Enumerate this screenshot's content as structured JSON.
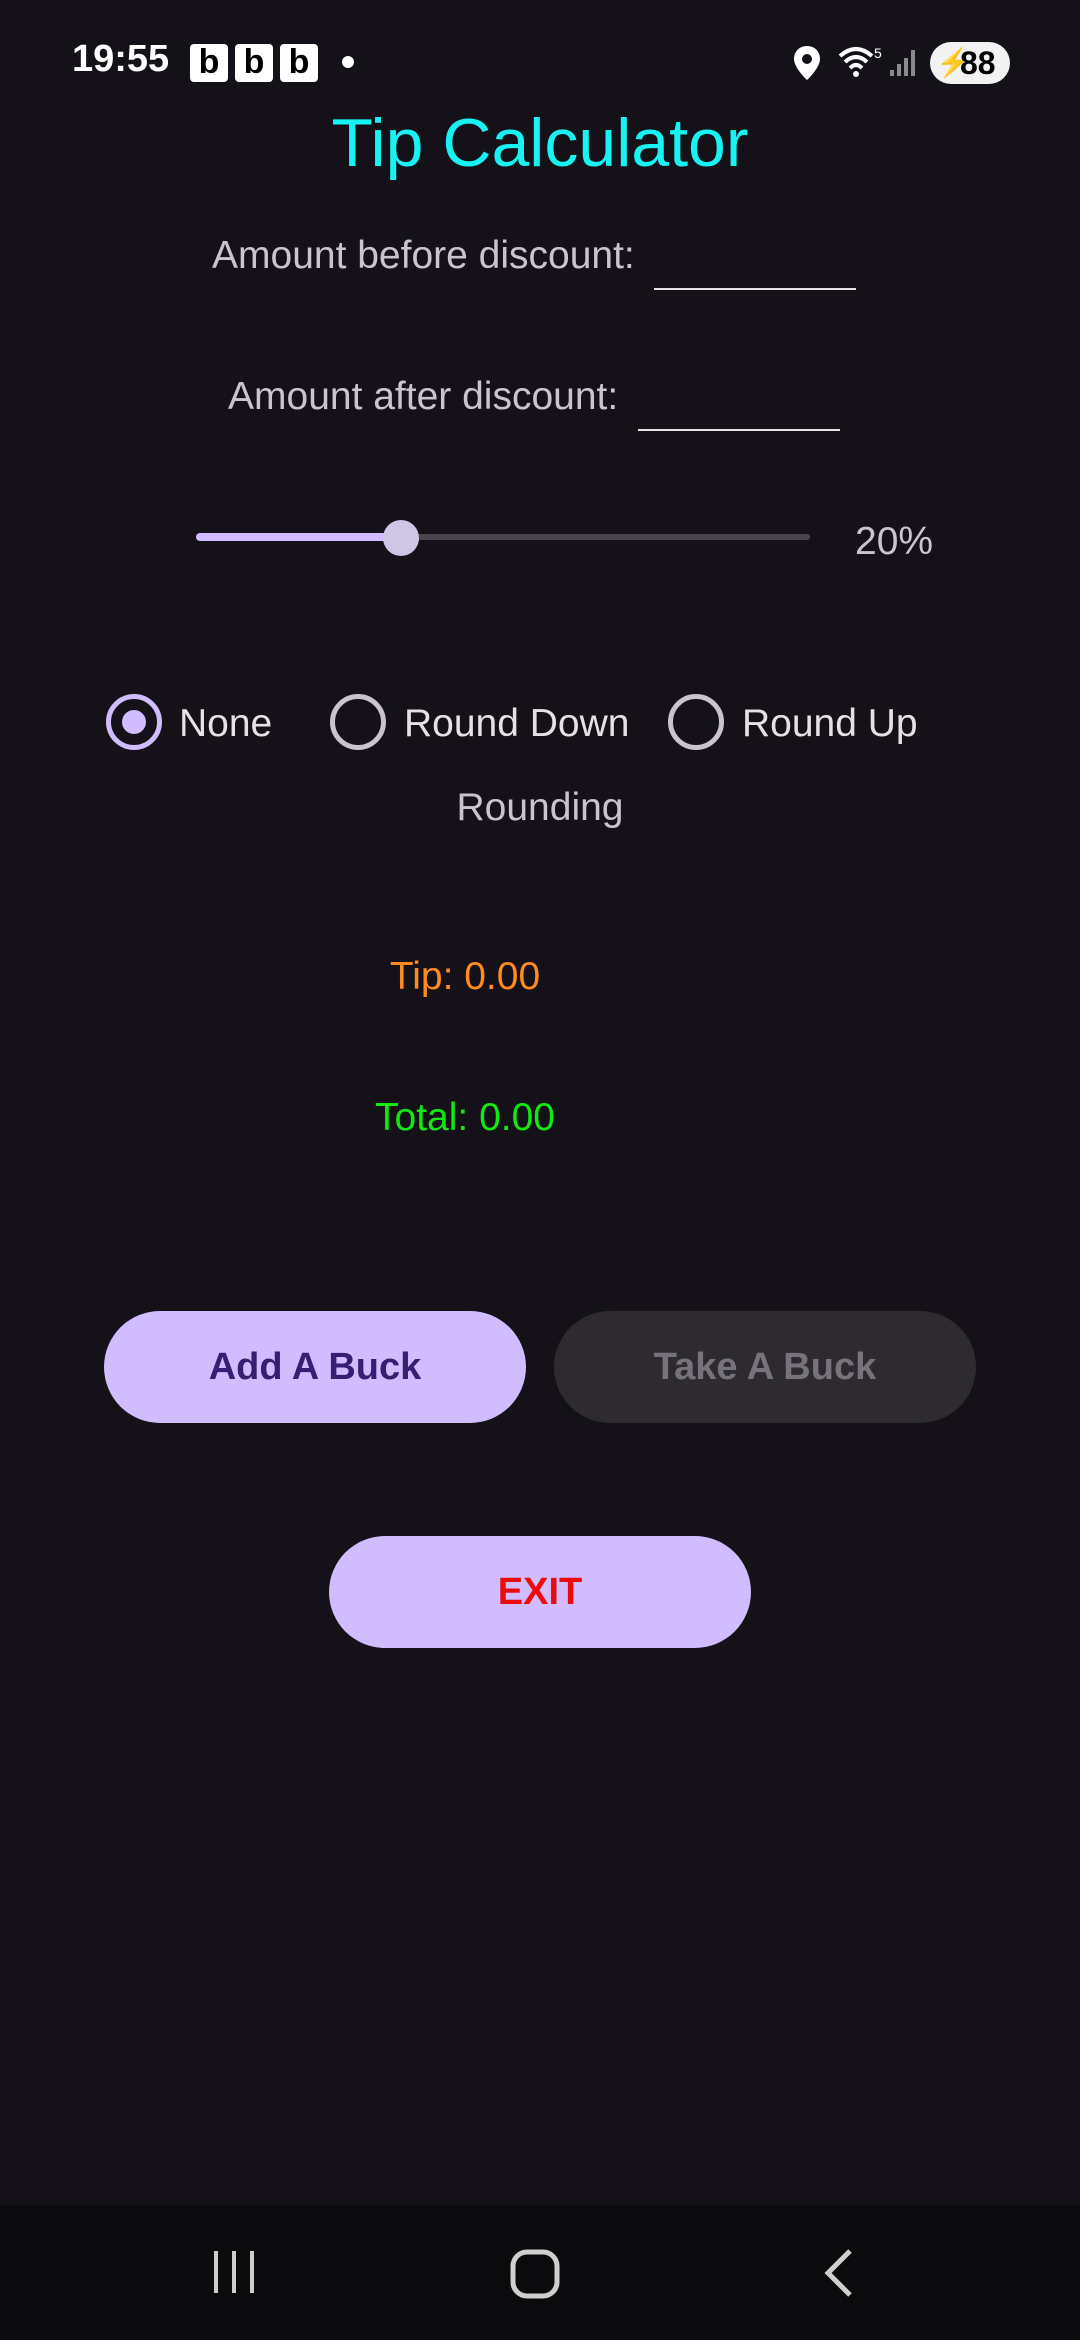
{
  "status_bar": {
    "time": "19:55",
    "notification_badges": [
      "b",
      "b",
      "b"
    ],
    "battery": "88",
    "icons": [
      "location-icon",
      "wifi-icon",
      "signal-icon",
      "battery-charging-icon"
    ],
    "wifi_label": "5"
  },
  "app": {
    "title": "Tip Calculator",
    "amount_before_label": "Amount before discount:",
    "amount_before_value": "",
    "amount_after_label": "Amount after discount:",
    "amount_after_value": "",
    "tip_percent": 20,
    "tip_percent_label": "20%",
    "rounding": {
      "options": [
        "None",
        "Round Down",
        "Round Up"
      ],
      "selected": "None",
      "label": "Rounding"
    },
    "tip_text": "Tip: 0.00",
    "total_text": "Total: 0.00",
    "buttons": {
      "add": "Add A Buck",
      "take": "Take A Buck",
      "exit": "EXIT"
    }
  },
  "navigation": {
    "icons": [
      "recent-apps-icon",
      "home-icon",
      "back-icon"
    ]
  },
  "colors": {
    "background": "#141218",
    "title": "#17f3f3",
    "tip": "#ff8a1f",
    "total": "#12e812",
    "primary": "#d0bcff",
    "exit_text": "#ec0b0b"
  }
}
